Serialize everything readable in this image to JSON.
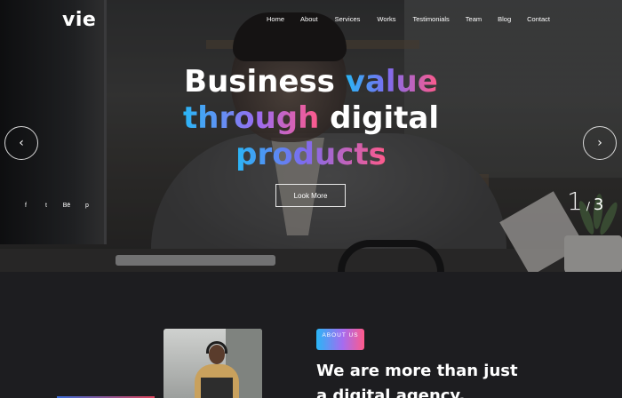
{
  "brand": {
    "logo": "vie"
  },
  "nav": {
    "items": [
      "Home",
      "About",
      "Services",
      "Works",
      "Testimonials",
      "Team",
      "Blog",
      "Contact"
    ]
  },
  "hero": {
    "headline_line1_a": "Business",
    "headline_line1_b": "value",
    "headline_line2_a": "through",
    "headline_line2_b": "digital",
    "headline_line3": "products",
    "cta_label": "Look More",
    "prev_arrow": "‹",
    "next_arrow": "›",
    "social": [
      "f",
      "t",
      "Bē",
      "p"
    ],
    "slide_current": "1",
    "slide_separator": "/",
    "slide_total": "3"
  },
  "about": {
    "badge": "ABOUT US",
    "title_line1": "We are more than just",
    "title_line2": "a digital agency."
  },
  "colors": {
    "background": "#1d1d20",
    "gradient_start": "#29b6f6",
    "gradient_mid": "#7c6cf0",
    "gradient_end": "#ff5a8a"
  }
}
